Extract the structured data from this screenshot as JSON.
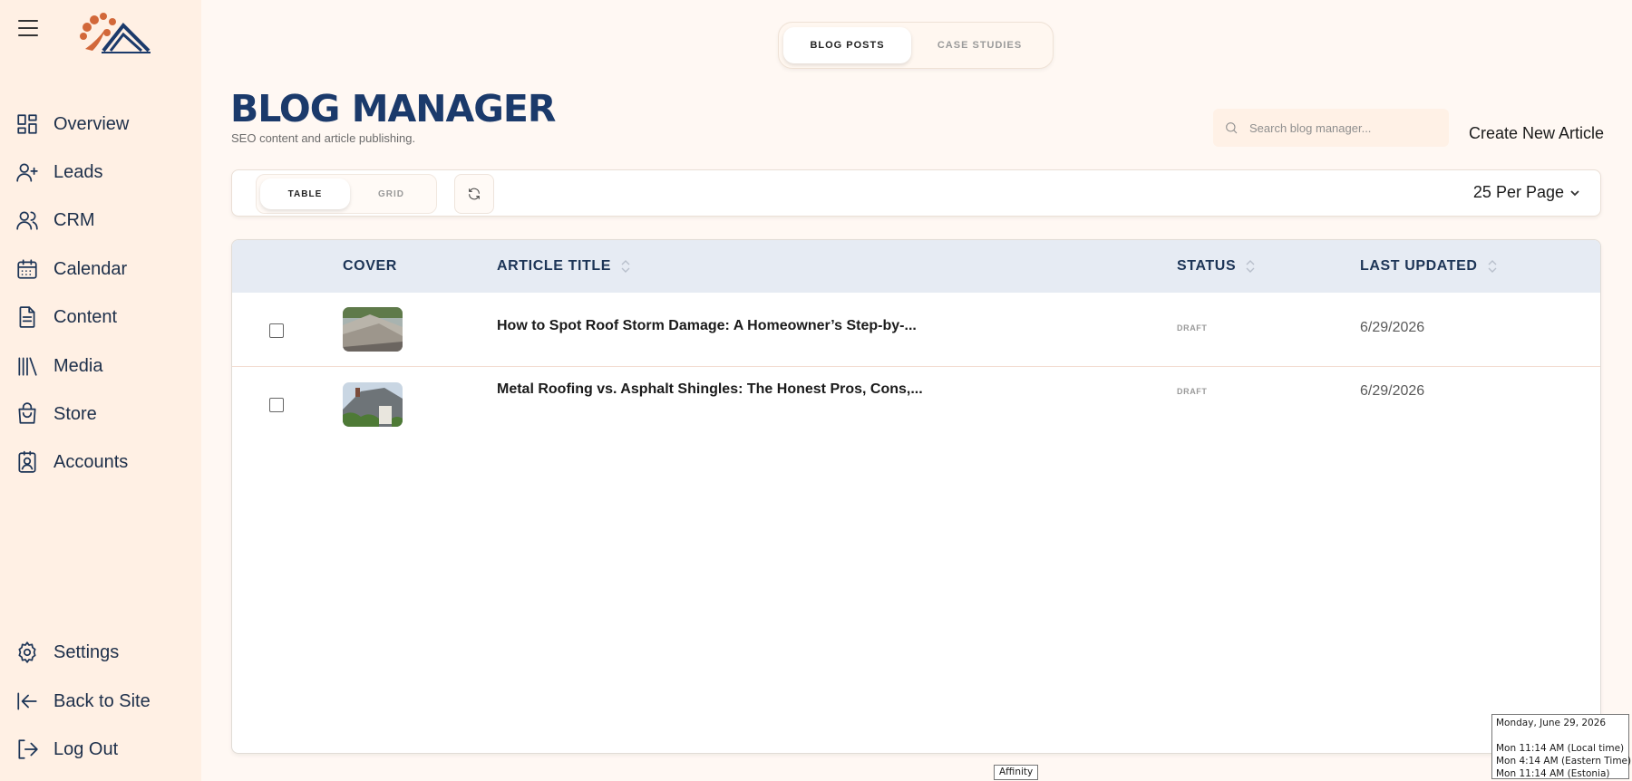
{
  "sidebar": {
    "items": [
      {
        "label": "Overview",
        "icon": "overview-grid-icon"
      },
      {
        "label": "Leads",
        "icon": "user-plus-icon"
      },
      {
        "label": "CRM",
        "icon": "users-icon"
      },
      {
        "label": "Calendar",
        "icon": "calendar-icon"
      },
      {
        "label": "Content",
        "icon": "document-icon"
      },
      {
        "label": "Media",
        "icon": "library-icon"
      },
      {
        "label": "Store",
        "icon": "shopping-bag-icon"
      },
      {
        "label": "Accounts",
        "icon": "contact-card-icon"
      }
    ],
    "bottom_items": [
      {
        "label": "Settings",
        "icon": "gear-icon"
      },
      {
        "label": "Back to Site",
        "icon": "arrow-left-bar-icon"
      },
      {
        "label": "Log Out",
        "icon": "logout-icon"
      }
    ]
  },
  "top_tabs": {
    "blog_posts": "BLOG POSTS",
    "case_studies": "CASE STUDIES"
  },
  "header": {
    "title": "BLOG MANAGER",
    "subtitle": "SEO content and article publishing.",
    "search_placeholder": "Search blog manager...",
    "create_label": "Create New Article"
  },
  "toolbar": {
    "table_label": "TABLE",
    "grid_label": "GRID",
    "per_page_label": "25 Per Page"
  },
  "table": {
    "columns": {
      "cover": "COVER",
      "title": "ARTICLE TITLE",
      "status": "STATUS",
      "updated": "LAST UPDATED"
    },
    "rows": [
      {
        "title": "How to Spot Roof Storm Damage: A Homeowner’s Step-by-...",
        "status": "DRAFT",
        "updated": "6/29/2026"
      },
      {
        "title": "Metal Roofing vs. Asphalt Shingles: The Honest Pros, Cons,...",
        "status": "DRAFT",
        "updated": "6/29/2026"
      }
    ]
  },
  "clock_tooltip": {
    "date": "Monday, June 29, 2026",
    "local": "Mon 11:14 AM  (Local time)",
    "eastern": "Mon 4:14 AM  (Eastern Time)",
    "estonia": "Mon 11:14 AM  (Estonia)"
  },
  "taskbar_tooltip": "Affinity",
  "colors": {
    "sidebar_bg": "#fff0e4",
    "page_bg": "#fff8f3",
    "title_blue": "#1b3a6b",
    "table_header_bg": "#e6ebf3"
  }
}
